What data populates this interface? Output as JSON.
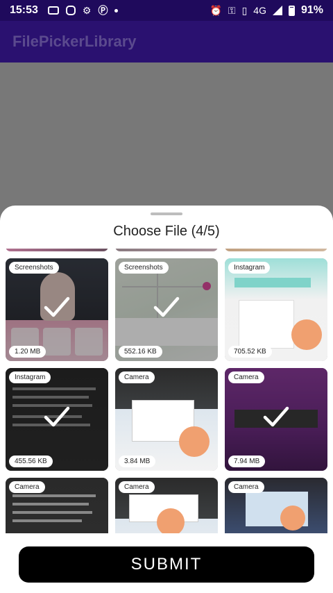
{
  "status_bar": {
    "time": "15:53",
    "network": "4G",
    "battery": "91%"
  },
  "app_bar": {
    "title": "FilePickerLibrary"
  },
  "sheet": {
    "title": "Choose File (4/5)",
    "submit_label": "SUBMIT"
  },
  "tiles": [
    {
      "folder": "Screenshots",
      "size": "1.20 MB",
      "selected": true,
      "art": "dark"
    },
    {
      "folder": "Screenshots",
      "size": "552.16 KB",
      "selected": true,
      "art": "map"
    },
    {
      "folder": "Instagram",
      "size": "705.52 KB",
      "selected": false,
      "art": "insta"
    },
    {
      "folder": "Instagram",
      "size": "455.56 KB",
      "selected": true,
      "art": "doc"
    },
    {
      "folder": "Camera",
      "size": "3.84 MB",
      "selected": false,
      "art": "code"
    },
    {
      "folder": "Camera",
      "size": "7.94 MB",
      "selected": true,
      "art": "purple"
    },
    {
      "folder": "Camera",
      "size": "",
      "selected": false,
      "art": "doc"
    },
    {
      "folder": "Camera",
      "size": "",
      "selected": false,
      "art": "code"
    },
    {
      "folder": "Camera",
      "size": "",
      "selected": false,
      "art": "photo"
    }
  ],
  "colors": {
    "status_bar": "#1f0a5c",
    "app_bar": "#2a1170",
    "submit": "#000000"
  },
  "icons": [
    "alarm-icon",
    "key-icon",
    "vibrate-icon",
    "signal-icon",
    "battery-icon",
    "checkmark-icon"
  ]
}
